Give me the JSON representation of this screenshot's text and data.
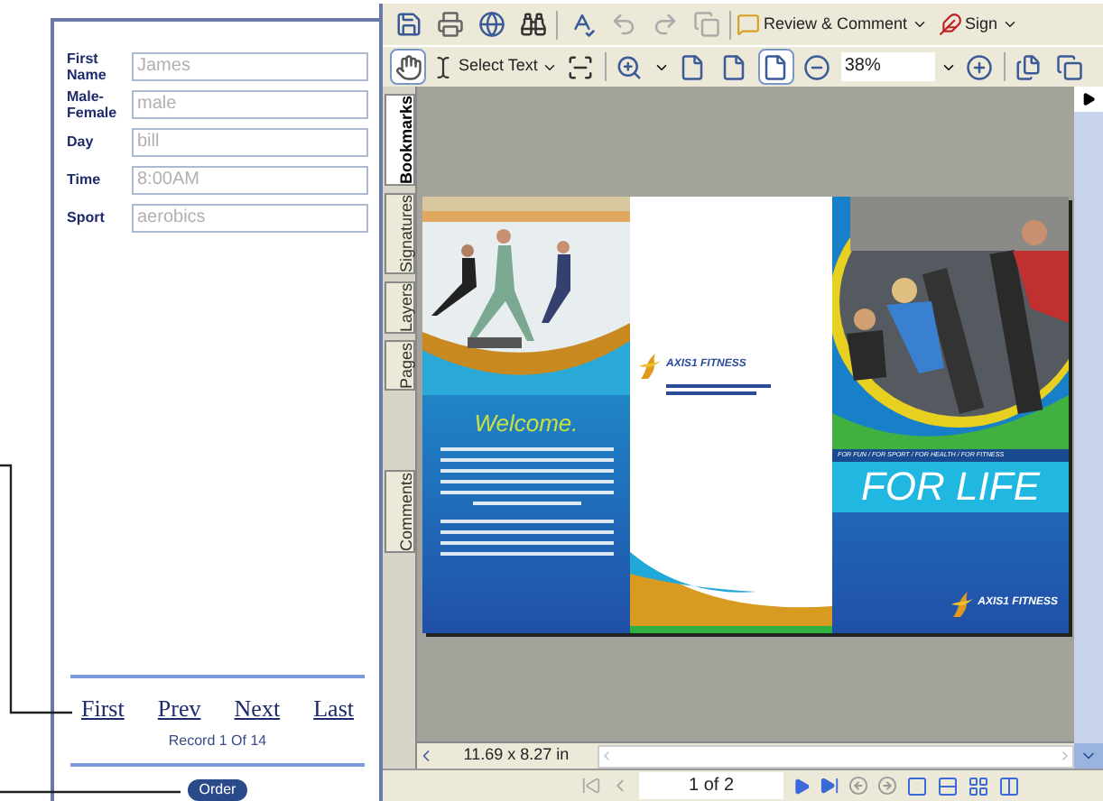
{
  "form": {
    "fields": [
      {
        "label": "First Name",
        "value": "James"
      },
      {
        "label": "Male-Female",
        "value": "male"
      },
      {
        "label": "Day",
        "value": "bill"
      },
      {
        "label": "Time",
        "value": "8:00AM"
      },
      {
        "label": "Sport",
        "value": "aerobics"
      }
    ],
    "nav_links": [
      "First",
      "Prev",
      "Next",
      "Last"
    ],
    "record": "Record 1 Of 14",
    "order_button": "Order"
  },
  "viewer": {
    "toolbar_1": {
      "review": "Review & Comment",
      "sign": "Sign"
    },
    "toolbar_2": {
      "select": "Select Text",
      "zoom": "38%"
    },
    "side_tabs": [
      {
        "label": "Bookmarks",
        "selected": true
      },
      {
        "label": "Signatures",
        "selected": false
      },
      {
        "label": "Layers",
        "selected": false
      },
      {
        "label": "Pages",
        "selected": false
      },
      {
        "label": "Comments",
        "selected": false
      }
    ],
    "document": {
      "welcome": "Welcome.",
      "brand": "AXIS1 FITNESS",
      "tagline": "FOR FUN / FOR SPORT / FOR HEALTH / FOR FITNESS",
      "headline": "FOR LIFE",
      "brand_footer": "AXIS1 FITNESS"
    },
    "page_size": "11.69 x 8.27 in",
    "page": "1 of 2"
  }
}
